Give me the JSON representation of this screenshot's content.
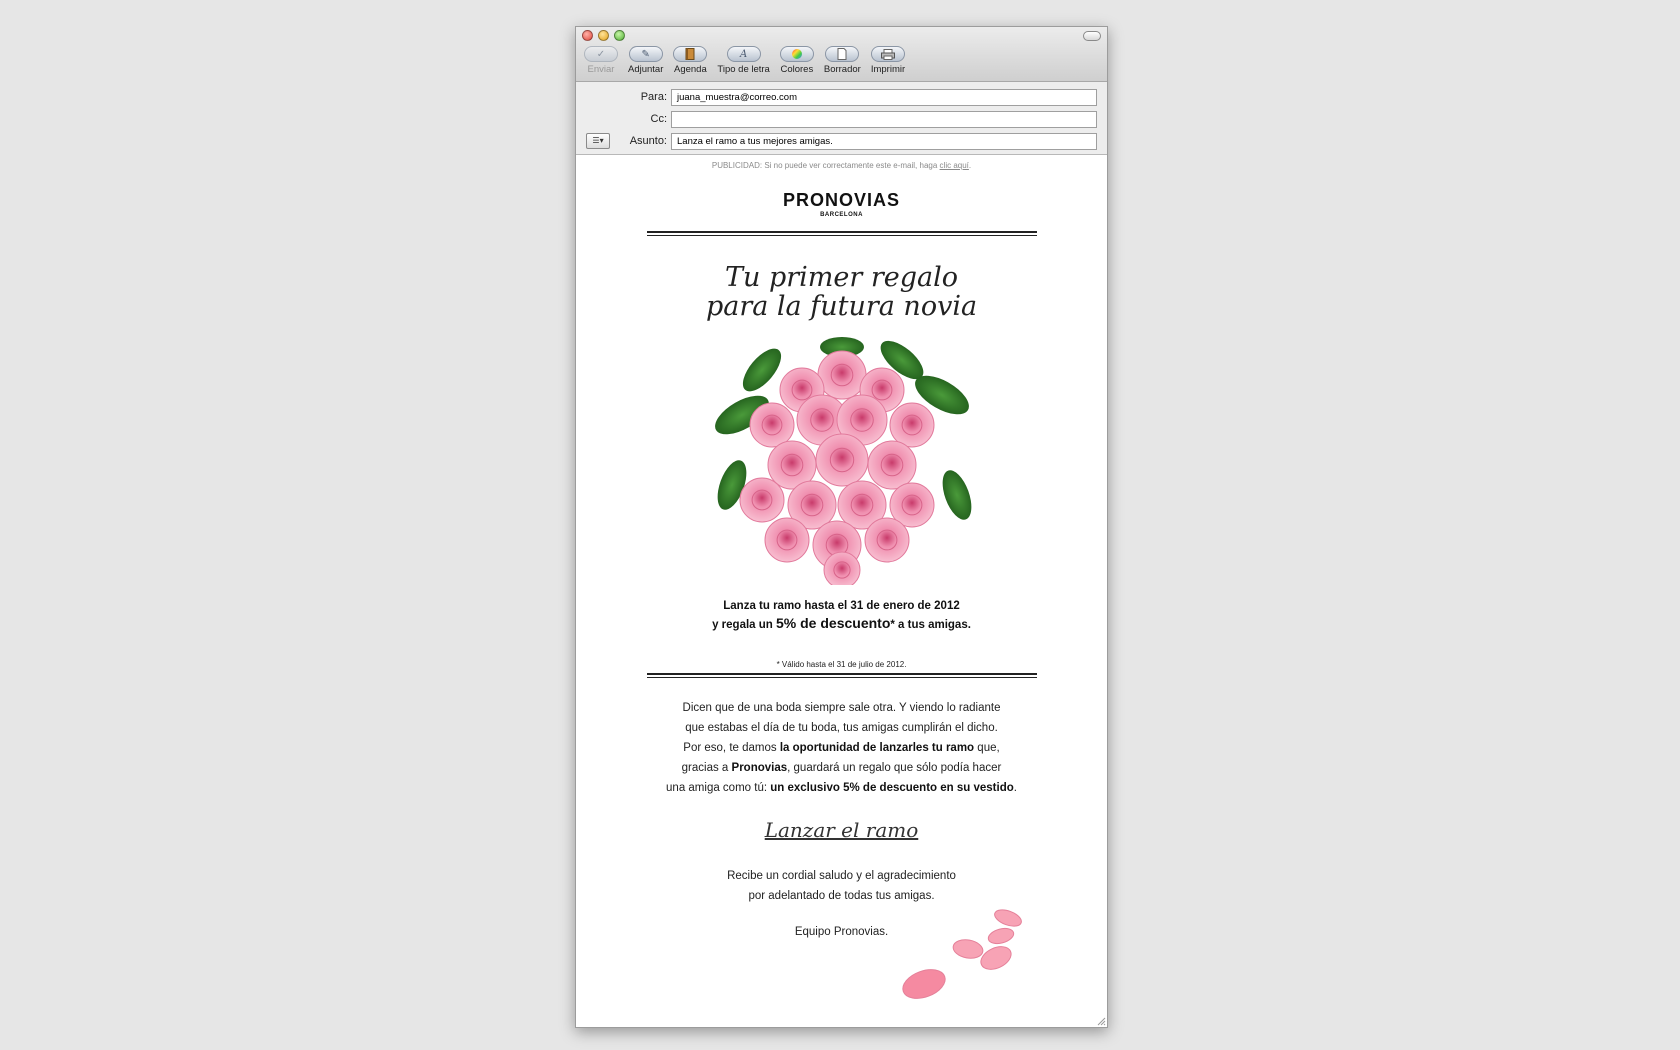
{
  "toolbar": {
    "send": "Enviar",
    "attach": "Adjuntar",
    "address": "Agenda",
    "fonts": "Tipo de letra",
    "colors": "Colores",
    "draft": "Borrador",
    "print": "Imprimir"
  },
  "header": {
    "to_label": "Para:",
    "to_value": "juana_muestra@correo.com",
    "cc_label": "Cc:",
    "cc_value": "",
    "subject_label": "Asunto:",
    "subject_value": "Lanza el ramo a tus mejores amigas."
  },
  "email": {
    "ad_text": "PUBLICIDAD: Si no puede ver correctamente este e-mail, haga",
    "ad_link": "clic aquí",
    "ad_end": ".",
    "brand": "PRONOVIAS",
    "brand_sub": "BARCELONA",
    "headline_1": "Tu primer regalo",
    "headline_2": "para la futura novia",
    "offer_1": "Lanza tu ramo hasta el 31 de enero de 2012",
    "offer_2a": "y regala un",
    "offer_2b": "5% de descuento",
    "offer_2c": "* a tus amigas.",
    "footnote": "* Válido hasta el 31 de julio de 2012.",
    "p1": "Dicen que de una boda siempre sale otra. Y viendo lo radiante",
    "p2": "que estabas el día de tu boda, tus amigas cumplirán el dicho.",
    "p3a": "Por eso, te damos",
    "p3b": "la oportunidad de lanzarles tu ramo",
    "p3c": "que,",
    "p4a": "gracias a",
    "p4b": "Pronovias",
    "p4c": ", guardará un regalo que sólo podía hacer",
    "p5a": "una amiga como tú:",
    "p5b": "un exclusivo 5% de descuento en su vestido",
    "p5c": ".",
    "cta": "Lanzar el ramo",
    "sign_1": "Recibe un cordial saludo y el agradecimiento",
    "sign_2": "por adelantado de todas tus amigas.",
    "team": "Equipo Pronovias."
  }
}
